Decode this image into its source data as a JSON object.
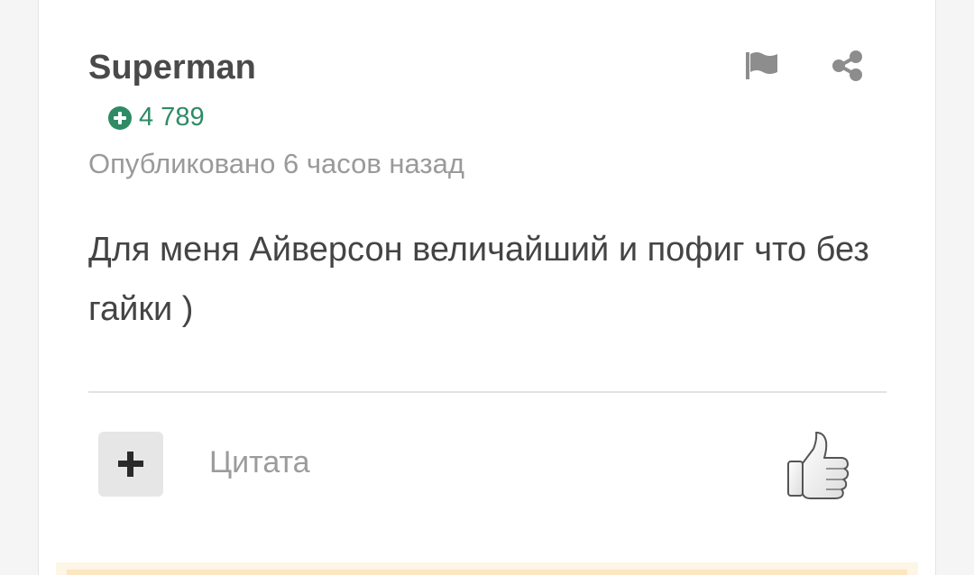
{
  "post": {
    "author": "Superman",
    "reputation": "4 789",
    "posted": "Опубликовано 6 часов назад",
    "content": "Для меня Айверсон величайший и пофиг что без гайки )"
  },
  "actions": {
    "quote_label": "Цитата"
  },
  "icons": {
    "reputation": "plus-circle-icon",
    "report": "flag-icon",
    "share": "share-icon",
    "multiquote": "plus-icon",
    "like": "thumbs-up-icon"
  },
  "colors": {
    "reputation": "#2e8b65",
    "author": "#4a4a4a",
    "muted": "#9a9a9a",
    "stripe": "#fdf5e6"
  }
}
